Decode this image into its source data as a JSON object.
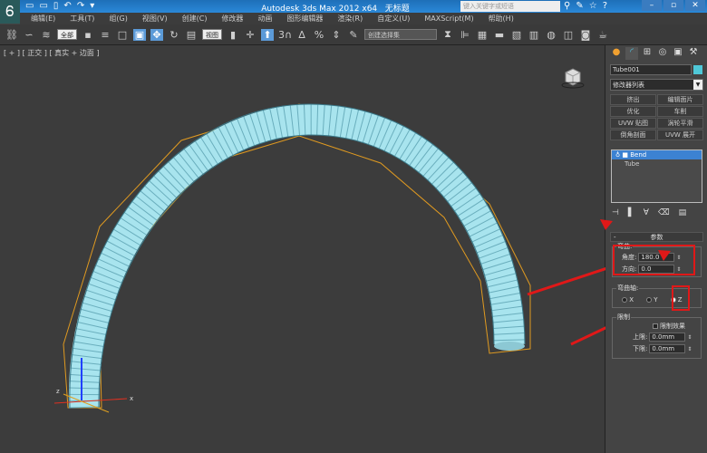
{
  "title_bar": {
    "app_title": "Autodesk 3ds Max  2012 x64",
    "doc_title": "无标题",
    "search_placeholder": "键入关键字或短语",
    "minimize": "–",
    "restore": "▫",
    "close": "✕"
  },
  "menu": [
    "编辑(E)",
    "工具(T)",
    "组(G)",
    "视图(V)",
    "创建(C)",
    "修改器",
    "动画",
    "图形编辑器",
    "渲染(R)",
    "自定义(U)",
    "MAXScript(M)",
    "帮助(H)"
  ],
  "toolbar": {
    "selection_filter": "全部",
    "reference_coord": "视图",
    "named_selection": "创建选择集"
  },
  "viewport": {
    "label": "[ + ] [ 正交 ] [ 真实 + 边面 ]",
    "gizmo_x": "x",
    "gizmo_z": "z",
    "colors": {
      "tube": "#a8e4ee",
      "wire": "#2a6a7a",
      "bbox": "#e09a20",
      "arrow": "#e01818"
    }
  },
  "panel": {
    "object_name": "Tube001",
    "modifier_list": "修改器列表",
    "modifier_buttons": [
      "挤出",
      "编辑面片",
      "优化",
      "车削",
      "UVW 贴图",
      "涡轮平滑",
      "倒角剖面",
      "UVW 展开"
    ],
    "stack": [
      {
        "label": "Bend",
        "selected": true
      },
      {
        "label": "Tube",
        "selected": false
      }
    ],
    "rollout_title": "参数",
    "bend_group": "弯曲:",
    "angle_label": "角度:",
    "angle_value": "180.0",
    "direction_label": "方向:",
    "direction_value": "0.0",
    "axis_group": "弯曲轴:",
    "axes": [
      {
        "label": "X",
        "selected": false
      },
      {
        "label": "Y",
        "selected": false
      },
      {
        "label": "Z",
        "selected": true
      }
    ],
    "limits_group": "限制",
    "limit_effect": "限制效果",
    "limit_effect_checked": false,
    "upper_label": "上限:",
    "upper_value": "0.0mm",
    "lower_label": "下限:",
    "lower_value": "0.0mm"
  }
}
